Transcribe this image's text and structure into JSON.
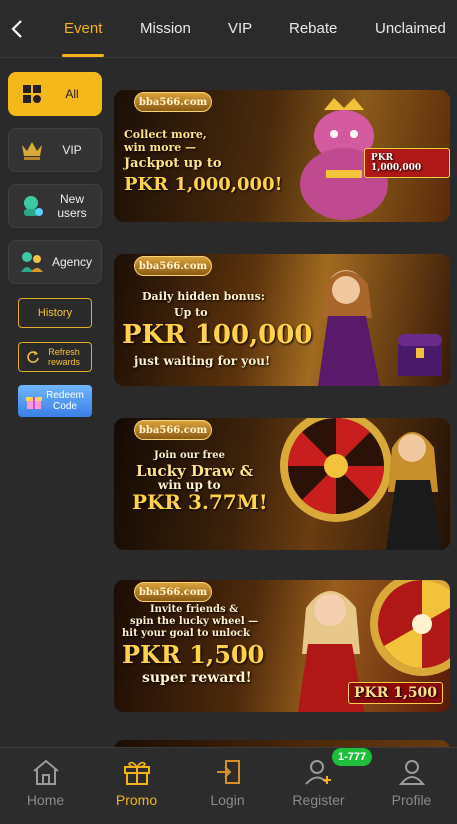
{
  "tabs": [
    "Event",
    "Mission",
    "VIP",
    "Rebate",
    "Unclaimed"
  ],
  "active_tab": "Event",
  "categories": [
    {
      "label": "All",
      "icon": "grid-icon",
      "active": true
    },
    {
      "label": "VIP",
      "icon": "crown-icon",
      "active": false
    },
    {
      "label": "New users",
      "icon": "new-user-icon",
      "active": false
    },
    {
      "label": "Agency",
      "icon": "agency-icon",
      "active": false
    }
  ],
  "buttons": {
    "history": "History",
    "refresh": "Refresh rewards",
    "redeem": "Redeem Code"
  },
  "banners": [
    {
      "logo": "bba566.com",
      "line1": "Collect more,",
      "line2": "win more —",
      "line3": "Jackpot up to",
      "line4": "PKR 1,000,000!",
      "tag": "PKR 1,000,000"
    },
    {
      "logo": "bba566.com",
      "line1": "Daily hidden bonus:",
      "line2": "Up to",
      "line3": "PKR 100,000",
      "line4": "just waiting for you!"
    },
    {
      "logo": "bba566.com",
      "line1": "Join our free",
      "line2": "Lucky Draw &",
      "line3": "win up to",
      "line4": "PKR 3.77M!"
    },
    {
      "logo": "bba566.com",
      "line1": "Invite friends &",
      "line2": "spin the lucky wheel —",
      "line3": "hit your goal to unlock",
      "line4": "PKR 1,500",
      "line5": "super reward!",
      "tag": "PKR 1,500"
    }
  ],
  "nav": [
    {
      "label": "Home",
      "icon": "home-icon"
    },
    {
      "label": "Promo",
      "icon": "gift-icon"
    },
    {
      "label": "Login",
      "icon": "login-icon"
    },
    {
      "label": "Register",
      "icon": "add-user-icon"
    },
    {
      "label": "Profile",
      "icon": "profile-icon"
    }
  ],
  "active_nav": "Promo",
  "register_badge": "1-777",
  "colors": {
    "accent": "#f3b31a",
    "background": "#2a2a2a",
    "badge": "#1fbf3c"
  }
}
